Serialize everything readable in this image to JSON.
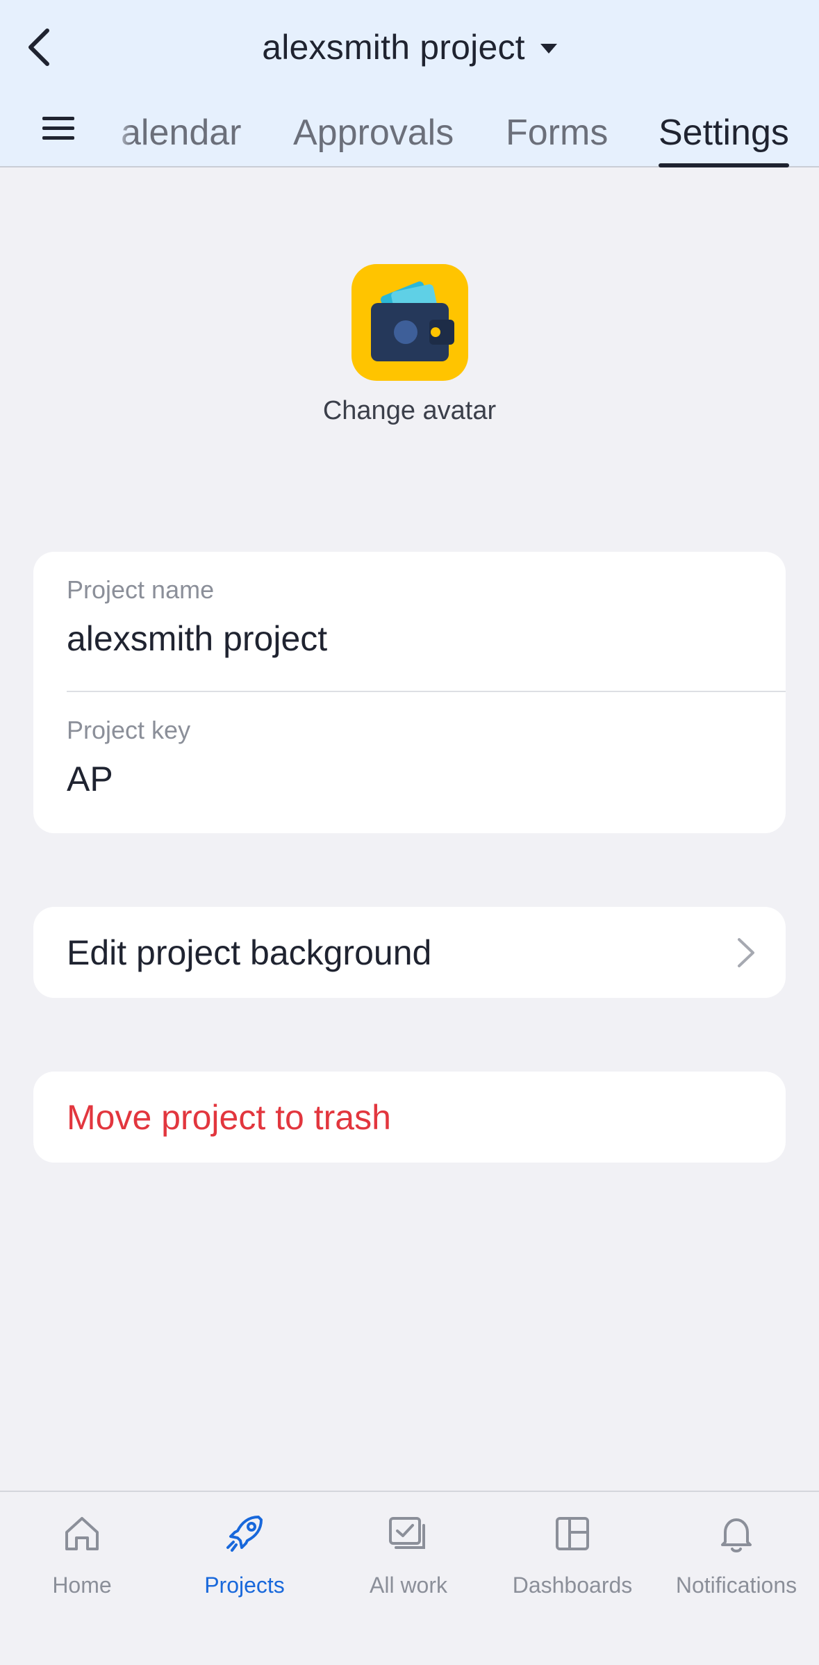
{
  "header": {
    "title": "alexsmith project",
    "tabs": [
      {
        "label": "alendar",
        "active": false
      },
      {
        "label": "Approvals",
        "active": false
      },
      {
        "label": "Forms",
        "active": false
      },
      {
        "label": "Settings",
        "active": true
      }
    ]
  },
  "avatar": {
    "icon": "wallet-icon",
    "change_label": "Change avatar"
  },
  "project_info": {
    "name_label": "Project name",
    "name_value": "alexsmith project",
    "key_label": "Project key",
    "key_value": "AP"
  },
  "actions": {
    "edit_background": "Edit project background",
    "move_to_trash": "Move project to trash"
  },
  "bottom_nav": [
    {
      "label": "Home",
      "icon": "home-icon",
      "active": false
    },
    {
      "label": "Projects",
      "icon": "rocket-icon",
      "active": true
    },
    {
      "label": "All work",
      "icon": "checkbox-stack-icon",
      "active": false
    },
    {
      "label": "Dashboards",
      "icon": "dashboard-icon",
      "active": false
    },
    {
      "label": "Notifications",
      "icon": "bell-icon",
      "active": false
    }
  ],
  "colors": {
    "header_bg": "#e6f0fd",
    "accent": "#1868db",
    "danger": "#e2363e",
    "avatar_bg": "#ffc400"
  }
}
